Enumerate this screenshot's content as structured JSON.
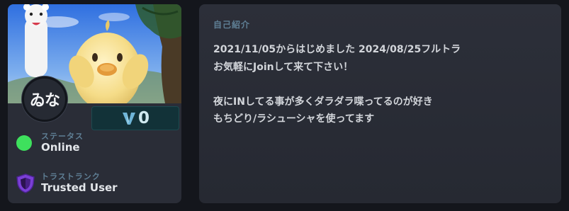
{
  "profile": {
    "display_name": "ゐな",
    "vcoin_count": "0",
    "status": {
      "label": "ステータス",
      "value": "Online",
      "color": "#3ee05d"
    },
    "trust": {
      "label": "トラストランク",
      "value": "Trusted User",
      "color": "#7b3fd6"
    }
  },
  "bio_section": {
    "title": "自己紹介",
    "lines": [
      "2021/11/05からはじめました 2024/08/25フルトラ",
      "お気軽にJoinして来て下さい！",
      "",
      "夜にINしてる事が多くダラダラ喋ってるのが好き",
      "もちどり/ラシューシャを使ってます"
    ]
  },
  "colors": {
    "background": "#14161c",
    "card": "#2a2d37",
    "accent_label": "#5f7f95",
    "badge_bg": "#123238"
  },
  "icons": {
    "status": "status-online-dot-icon",
    "trust": "shield-icon",
    "vcoin": "v-logo-icon"
  }
}
